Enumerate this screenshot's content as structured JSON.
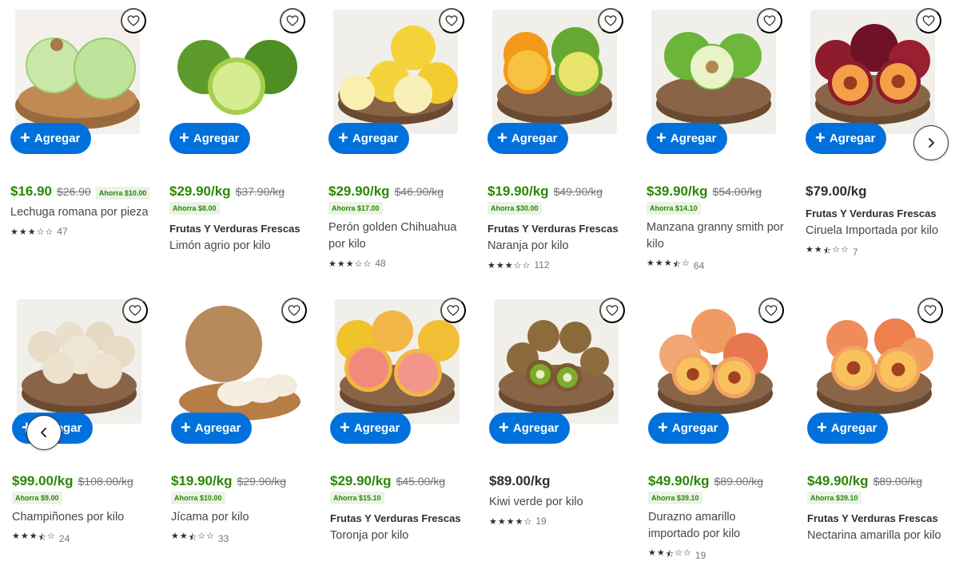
{
  "add_label": "Agregar",
  "colors": {
    "accent": "#0071dc",
    "sale_price": "#2a8703",
    "save_badge_bg": "#eaf3e6"
  },
  "nav": {
    "next_icon": "chevron-right-icon",
    "prev_icon": "chevron-left-icon"
  },
  "products": [
    {
      "id": "lechuga",
      "price": "$16.90",
      "was": "$26.90",
      "save": "Ahorra $10.00",
      "save_inline": true,
      "brand": "",
      "name": "Lechuga romana por pieza",
      "rating": 3,
      "reviews": "47",
      "image": "lettuce"
    },
    {
      "id": "limon",
      "price": "$29.90/kg",
      "was": "$37.90/kg",
      "save": "Ahorra $8.00",
      "brand": "Frutas Y Verduras Frescas",
      "name": "Limón agrio por kilo",
      "rating": 0,
      "reviews": "",
      "image": "lime"
    },
    {
      "id": "peron",
      "price": "$29.90/kg",
      "was": "$46.90/kg",
      "save": "Ahorra $17.00",
      "brand": "",
      "name": "Perón golden Chihuahua por kilo",
      "rating": 3,
      "reviews": "48",
      "image": "golden-apple"
    },
    {
      "id": "naranja",
      "price": "$19.90/kg",
      "was": "$49.90/kg",
      "save": "Ahorra $30.00",
      "brand": "Frutas Y Verduras Frescas",
      "name": "Naranja por kilo",
      "rating": 3,
      "reviews": "112",
      "image": "orange"
    },
    {
      "id": "manzana",
      "price": "$39.90/kg",
      "was": "$54.00/kg",
      "save": "Ahorra $14.10",
      "brand": "",
      "name": "Manzana granny smith por kilo",
      "rating": 3.5,
      "reviews": "64",
      "image": "green-apple"
    },
    {
      "id": "ciruela",
      "price": "$79.00/kg",
      "was": "",
      "save": "",
      "brand": "Frutas Y Verduras Frescas",
      "name": "Ciruela Importada por kilo",
      "rating": 2.5,
      "reviews": "7",
      "image": "plum"
    },
    {
      "id": "champinones",
      "price": "$99.00/kg",
      "was": "$108.00/kg",
      "save": "Ahorra $9.00",
      "brand": "",
      "name": "Champiñones por kilo",
      "rating": 3.5,
      "reviews": "24",
      "image": "mushroom"
    },
    {
      "id": "jicama",
      "price": "$19.90/kg",
      "was": "$29.90/kg",
      "save": "Ahorra $10.00",
      "brand": "",
      "name": "Jícama por kilo",
      "rating": 2.5,
      "reviews": "33",
      "image": "jicama"
    },
    {
      "id": "toronja",
      "price": "$29.90/kg",
      "was": "$45.00/kg",
      "save": "Ahorra $15.10",
      "brand": "Frutas Y Verduras Frescas",
      "name": "Toronja por kilo",
      "rating": 0,
      "reviews": "",
      "image": "grapefruit"
    },
    {
      "id": "kiwi",
      "price": "$89.00/kg",
      "was": "",
      "save": "",
      "brand": "",
      "name": "Kiwi verde por kilo",
      "rating": 4,
      "reviews": "19",
      "image": "kiwi"
    },
    {
      "id": "durazno",
      "price": "$49.90/kg",
      "was": "$89.00/kg",
      "save": "Ahorra $39.10",
      "brand": "",
      "name": "Durazno amarillo importado por kilo",
      "rating": 2.5,
      "reviews": "19",
      "image": "peach"
    },
    {
      "id": "nectarina",
      "price": "$49.90/kg",
      "was": "$89.00/kg",
      "save": "Ahorra $39.10",
      "brand": "Frutas Y Verduras Frescas",
      "name": "Nectarina amarilla por kilo",
      "rating": 0,
      "reviews": "",
      "image": "nectarine"
    }
  ]
}
